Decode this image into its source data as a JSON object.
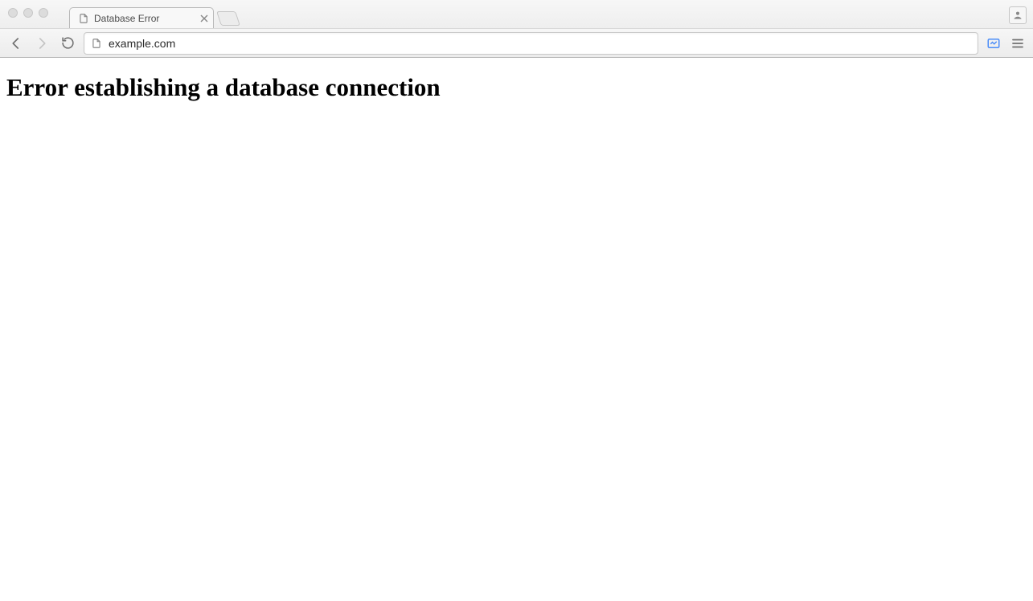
{
  "tab": {
    "title": "Database Error"
  },
  "address": {
    "url": "example.com"
  },
  "page": {
    "heading": "Error establishing a database connection"
  }
}
